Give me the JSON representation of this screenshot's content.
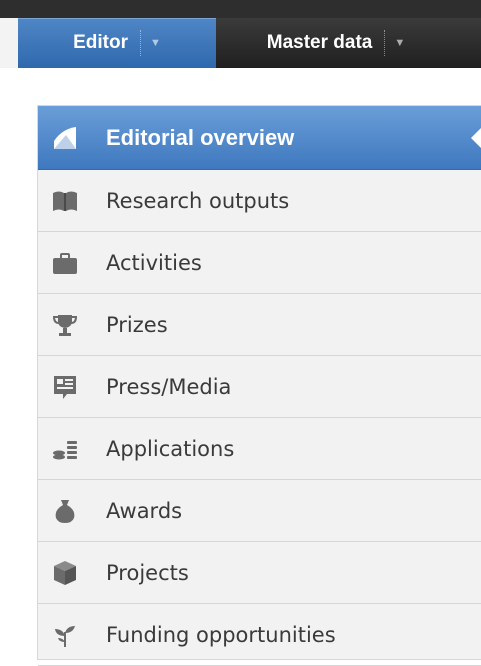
{
  "nav": {
    "tabs": [
      {
        "label": "Editor",
        "active": true
      },
      {
        "label": "Master data",
        "active": false
      }
    ]
  },
  "menu": {
    "items": [
      {
        "label": "Editorial overview",
        "icon": "editorial-overview-icon",
        "active": true
      },
      {
        "label": "Research outputs",
        "icon": "book-icon"
      },
      {
        "label": "Activities",
        "icon": "briefcase-icon"
      },
      {
        "label": "Prizes",
        "icon": "trophy-icon"
      },
      {
        "label": "Press/Media",
        "icon": "newspaper-icon"
      },
      {
        "label": "Applications",
        "icon": "coins-icon"
      },
      {
        "label": "Awards",
        "icon": "money-bag-icon"
      },
      {
        "label": "Projects",
        "icon": "box-icon"
      },
      {
        "label": "Funding opportunities",
        "icon": "sprout-icon"
      }
    ]
  },
  "colors": {
    "accent": "#4a84c9",
    "nav_background": "#2b2b2b",
    "icon_gray": "#6b6b6b",
    "panel_background": "#f2f2f2"
  }
}
